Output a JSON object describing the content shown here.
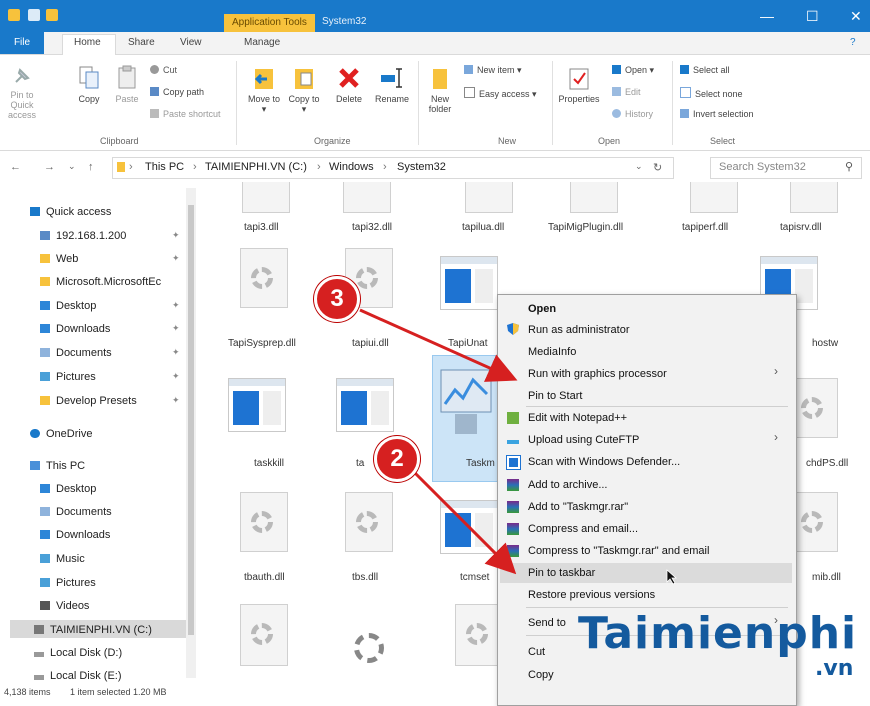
{
  "titlebar": {
    "app_tools": "Application Tools",
    "title": "System32",
    "minimize": "—",
    "maximize": "☐",
    "close": "✕"
  },
  "ribbon_tabs": {
    "file": "File",
    "home": "Home",
    "share": "Share",
    "view": "View",
    "manage": "Manage"
  },
  "ribbon": {
    "clipboard": {
      "pin": "Pin to Quick access",
      "copy": "Copy",
      "paste": "Paste",
      "cut": "Cut",
      "copy_path": "Copy path",
      "paste_shortcut": "Paste shortcut",
      "group": "Clipboard"
    },
    "organize": {
      "move_to": "Move to ▾",
      "copy_to": "Copy to ▾",
      "delete": "Delete",
      "rename": "Rename",
      "group": "Organize"
    },
    "new": {
      "new_folder": "New folder",
      "new_item": "New item ▾",
      "easy_access": "Easy access ▾",
      "group": "New"
    },
    "open": {
      "properties": "Properties",
      "open": "Open ▾",
      "edit": "Edit",
      "history": "History",
      "group": "Open"
    },
    "select": {
      "select_all": "Select all",
      "select_none": "Select none",
      "invert": "Invert selection",
      "group": "Select"
    }
  },
  "address": {
    "crumbs": [
      "This PC",
      "TAIMIENPHI.VN (C:)",
      "Windows",
      "System32"
    ],
    "search_placeholder": "Search System32"
  },
  "nav": {
    "quick_access": "Quick access",
    "items": [
      "192.168.1.200",
      "Web",
      "Microsoft.MicrosoftEc",
      "Desktop",
      "Downloads",
      "Documents",
      "Pictures",
      "Develop Presets"
    ],
    "onedrive": "OneDrive",
    "this_pc": "This PC",
    "pc_items": [
      "Desktop",
      "Documents",
      "Downloads",
      "Music",
      "Pictures",
      "Videos",
      "TAIMIENPHI.VN (C:)",
      "Local Disk (D:)",
      "Local Disk (E:)"
    ]
  },
  "files": {
    "row1": [
      "tapi3.dll",
      "tapi32.dll",
      "tapilua.dll",
      "TapiMigPlugin.dll",
      "tapiperf.dll",
      "tapisrv.dll"
    ],
    "row2": [
      "TapiSysprep.dll",
      "tapiui.dll",
      "TapiUnat",
      "hostw"
    ],
    "row3": [
      "taskkill",
      "ta",
      "Taskm",
      "chdPS.dll"
    ],
    "row4": [
      "tbauth.dll",
      "tbs.dll",
      "tcmset",
      "mib.dll"
    ]
  },
  "status": {
    "count": "4,138 items",
    "selected": "1 item selected  1.20 MB"
  },
  "context_menu": {
    "items": [
      "Open",
      "Run as administrator",
      "MediaInfo",
      "Run with graphics processor",
      "Pin to Start",
      "Edit with Notepad++",
      "Upload using CuteFTP",
      "Scan with Windows Defender...",
      "Add to archive...",
      "Add to \"Taskmgr.rar\"",
      "Compress and email...",
      "Compress to \"Taskmgr.rar\" and email",
      "Pin to taskbar",
      "Restore previous versions",
      "Send to",
      "Cut",
      "Copy"
    ],
    "submenu_arrow": "›"
  },
  "callouts": {
    "three": "3",
    "two": "2"
  },
  "watermark": {
    "text": "Taimienphi",
    "suffix": ".vn"
  },
  "colors": {
    "titlebar": "#1979ca",
    "selection": "#cce4f7",
    "callout": "#d62020",
    "arrow": "#d62020",
    "watermark": "#145a9e"
  }
}
